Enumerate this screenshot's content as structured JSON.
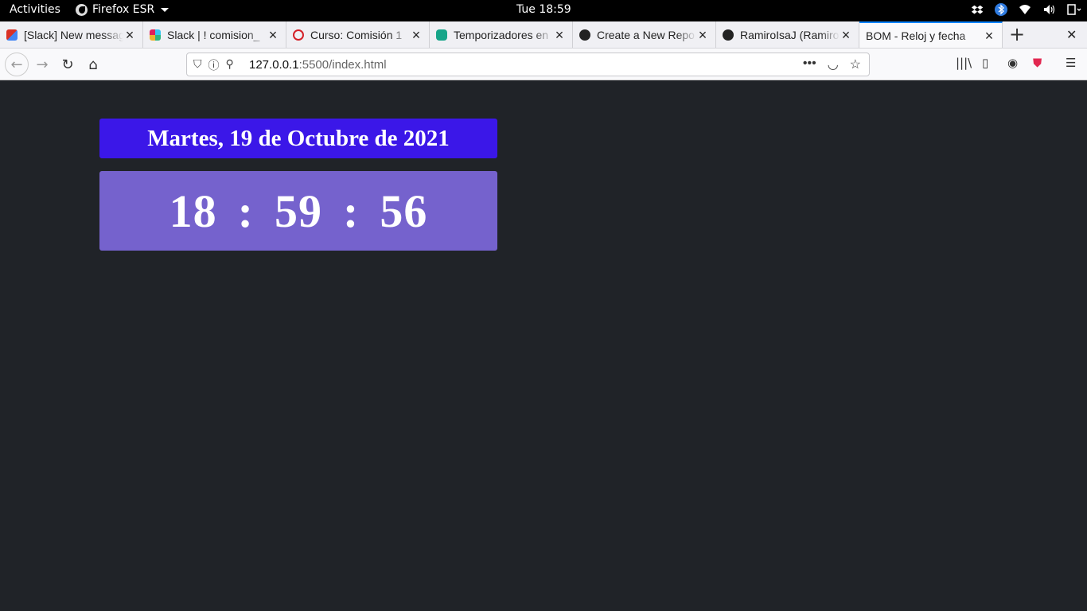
{
  "topbar": {
    "activities": "Activities",
    "app_name": "Firefox ESR",
    "clock": "Tue 18:59"
  },
  "tabs": [
    {
      "title": "[Slack] New message",
      "favicon": "gmail-icon",
      "color": "#d93025"
    },
    {
      "title": "Slack | ! comision_",
      "favicon": "slack-icon",
      "color": "#e01e5a"
    },
    {
      "title": "Curso: Comisión 1",
      "favicon": "course-icon",
      "color": "#d42027"
    },
    {
      "title": "Temporizadores en",
      "favicon": "teal-icon",
      "color": "#17a589"
    },
    {
      "title": "Create a New Repo",
      "favicon": "github-icon",
      "color": "#222222"
    },
    {
      "title": "RamiroIsaJ (Ramiro",
      "favicon": "github-icon",
      "color": "#222222"
    },
    {
      "title": "BOM - Reloj y fecha",
      "favicon": "none",
      "color": "",
      "active": true
    }
  ],
  "url": {
    "host": "127.0.0.1",
    "rest": ":5500/index.html"
  },
  "page": {
    "date_text": "Martes, 19 de Octubre de 2021",
    "hours": "18",
    "minutes": "59",
    "seconds": "56",
    "separator": ":"
  },
  "colors": {
    "page_bg": "#202328",
    "date_bg": "#3b17e8",
    "clock_bg": "#7562cd"
  }
}
